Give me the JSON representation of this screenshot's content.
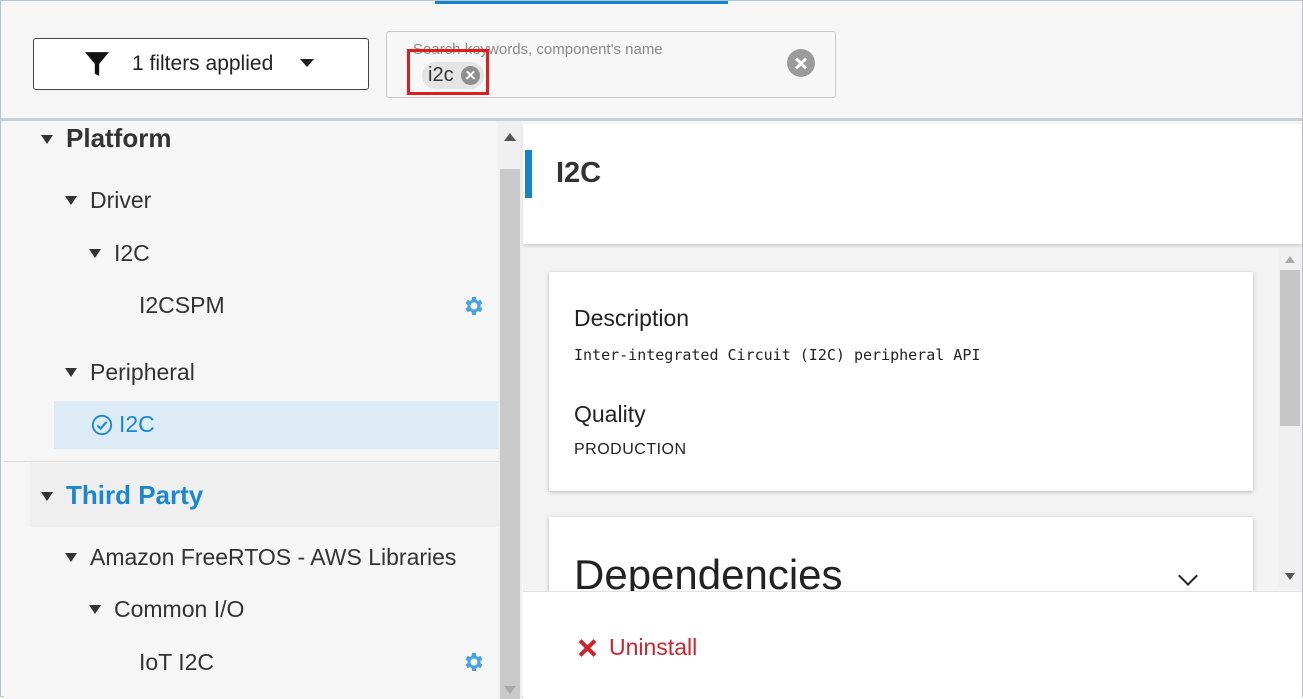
{
  "toolbar": {
    "filter_label": "1 filters applied",
    "search_placeholder": "Search keywords, component's name",
    "search_chip": "i2c"
  },
  "tree": {
    "categories": [
      {
        "label": "Platform",
        "groups": [
          {
            "label": "Driver",
            "subgroups": [
              {
                "label": "I2C",
                "items": [
                  {
                    "label": "I2CSPM",
                    "configurable": true
                  }
                ]
              }
            ]
          },
          {
            "label": "Peripheral",
            "items": [
              {
                "label": "I2C",
                "installed": true,
                "selected": true
              }
            ]
          }
        ]
      },
      {
        "label": "Third Party",
        "groups": [
          {
            "label": "Amazon FreeRTOS - AWS Libraries",
            "subgroups": [
              {
                "label": "Common I/O",
                "items": [
                  {
                    "label": "IoT I2C",
                    "configurable": true
                  }
                ]
              }
            ]
          }
        ]
      }
    ]
  },
  "detail": {
    "title": "I2C",
    "description_heading": "Description",
    "description_text": "Inter-integrated Circuit (I2C) peripheral API",
    "quality_heading": "Quality",
    "quality_value": "PRODUCTION",
    "dependencies_heading": "Dependencies",
    "uninstall_label": "Uninstall"
  },
  "colors": {
    "accent": "#1485cc",
    "danger": "#d0222b",
    "highlight": "#e01c1c",
    "gear": "#4aa3df"
  },
  "icons": [
    "filter-funnel-icon",
    "caret-down-icon",
    "chip-remove-icon",
    "clear-search-icon",
    "expand-arrow-icon",
    "gear-icon",
    "check-circle-icon",
    "chevron-down-icon",
    "close-x-icon"
  ]
}
